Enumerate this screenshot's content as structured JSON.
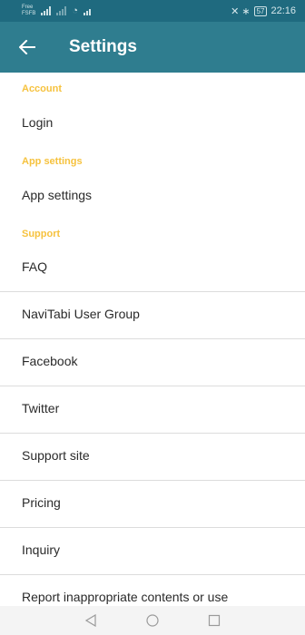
{
  "status_bar": {
    "carrier_line1": "Free",
    "carrier_line2": "FSFB",
    "right_icons": "✕ ∗",
    "battery": "57",
    "time": "22:16"
  },
  "app_bar": {
    "title": "Settings",
    "back_icon": "arrow-left-icon"
  },
  "sections": [
    {
      "header": "Account",
      "items": [
        "Login"
      ]
    },
    {
      "header": "App settings",
      "items": [
        "App settings"
      ]
    },
    {
      "header": "Support",
      "items": [
        "FAQ",
        "NaviTabi User Group",
        "Facebook",
        "Twitter",
        "Support site",
        "Pricing",
        "Inquiry",
        "Report inappropriate contents or use"
      ]
    }
  ],
  "colors": {
    "status_bar": "#1f6a7f",
    "app_bar": "#2f7d8f",
    "section_header": "#f6c23e",
    "divider": "#dcdcdc"
  },
  "nav_bar": {
    "back_icon": "triangle-back-icon",
    "home_icon": "circle-home-icon",
    "recents_icon": "square-recents-icon"
  }
}
